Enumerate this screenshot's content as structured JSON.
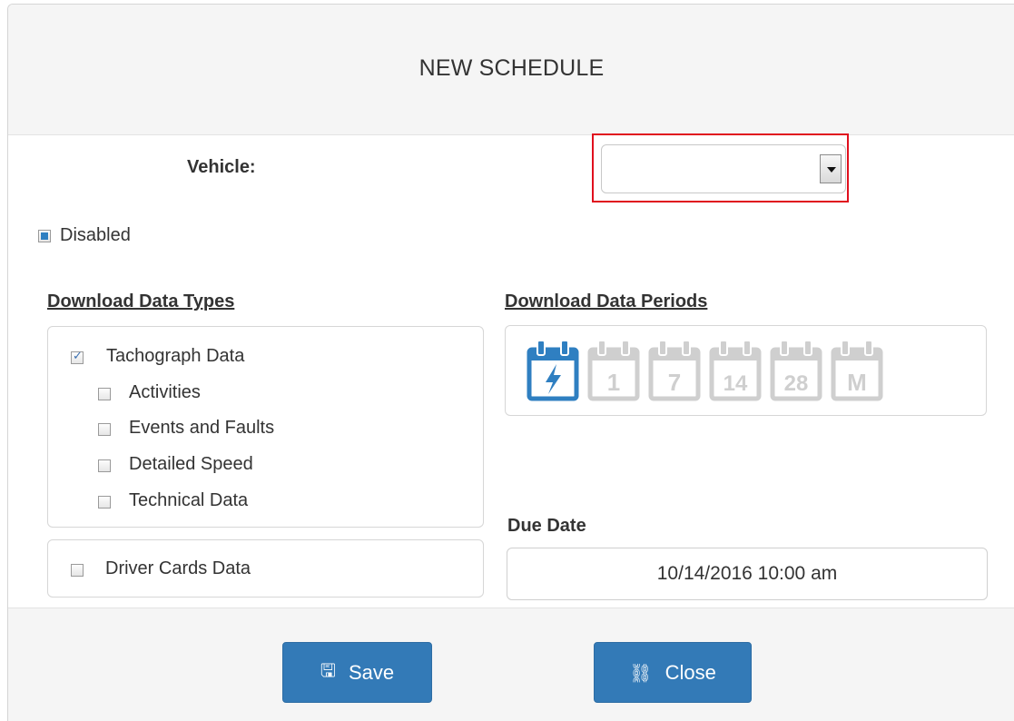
{
  "dialog": {
    "title": "NEW SCHEDULE"
  },
  "vehicle": {
    "label": "Vehicle:",
    "selected": ""
  },
  "disabled": {
    "label": "Disabled",
    "state": "indeterminate"
  },
  "data_types": {
    "heading": "Download Data Types",
    "tachograph": {
      "label": "Tachograph Data",
      "checked": true
    },
    "sub_items": [
      {
        "label": "Activities",
        "checked": false
      },
      {
        "label": "Events and Faults",
        "checked": false
      },
      {
        "label": "Detailed Speed",
        "checked": false
      },
      {
        "label": "Technical Data",
        "checked": false
      }
    ],
    "driver_cards": {
      "label": "Driver Cards Data",
      "checked": false
    }
  },
  "data_periods": {
    "heading": "Download Data Periods",
    "items": [
      {
        "glyph": "lightning-icon",
        "active": true
      },
      {
        "glyph": "1",
        "active": false
      },
      {
        "glyph": "7",
        "active": false
      },
      {
        "glyph": "14",
        "active": false
      },
      {
        "glyph": "28",
        "active": false
      },
      {
        "glyph": "M",
        "active": false
      }
    ],
    "active_color": "#2f7fc1",
    "inactive_color": "#cfcfcf"
  },
  "due_date": {
    "label": "Due Date",
    "value": "10/14/2016 10:00 am"
  },
  "buttons": {
    "save": "Save",
    "close": "Close"
  },
  "colors": {
    "primary": "#337ab7",
    "highlight": "#e0101e"
  }
}
